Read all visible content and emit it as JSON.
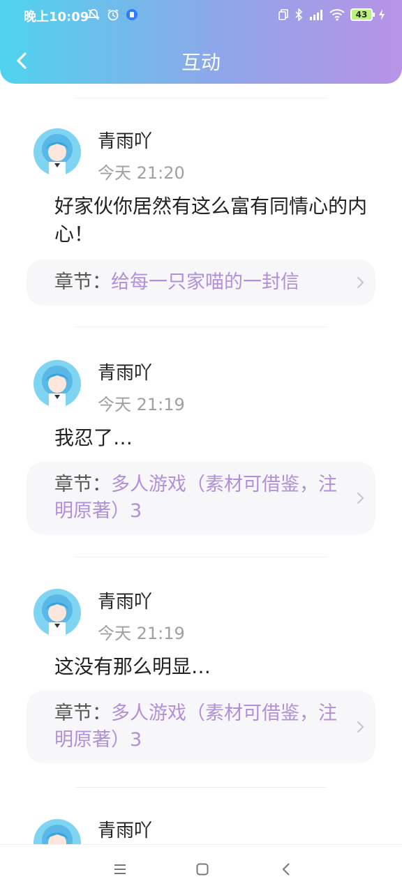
{
  "status_bar": {
    "time": "晚上10:09",
    "battery": "43",
    "icons_left": [
      "notification-off-icon",
      "alarm-icon",
      "app-badge-icon"
    ],
    "icons_right": [
      "dual-sim-icon",
      "bluetooth-icon",
      "signal-icon",
      "wifi-icon",
      "battery-icon",
      "charging-icon"
    ]
  },
  "header": {
    "title": "互动",
    "back_icon": "chevron-left-icon",
    "gradient": [
      "#4fd3ee",
      "#b893e6"
    ]
  },
  "colors": {
    "accent": "#b28fdb",
    "muted": "#a0a0a0",
    "card_bg": "#f7f7f9"
  },
  "feed": [
    {
      "username": "青雨吖",
      "time": "今天 21:20",
      "comment": "好家伙你居然有这么富有同情心的内心！",
      "chapter_prefix": "章节：",
      "chapter_title": "给每一只家喵的一封信"
    },
    {
      "username": "青雨吖",
      "time": "今天 21:19",
      "comment": "我忍了…",
      "chapter_prefix": "章节：",
      "chapter_title": "多人游戏（素材可借鉴，注明原著）3"
    },
    {
      "username": "青雨吖",
      "time": "今天 21:19",
      "comment": "这没有那么明显…",
      "chapter_prefix": "章节：",
      "chapter_title": "多人游戏（素材可借鉴，注明原著）3"
    },
    {
      "username": "青雨吖"
    }
  ],
  "bottom_nav": {
    "icons": [
      "menu-icon",
      "home-square-icon",
      "back-icon"
    ]
  }
}
